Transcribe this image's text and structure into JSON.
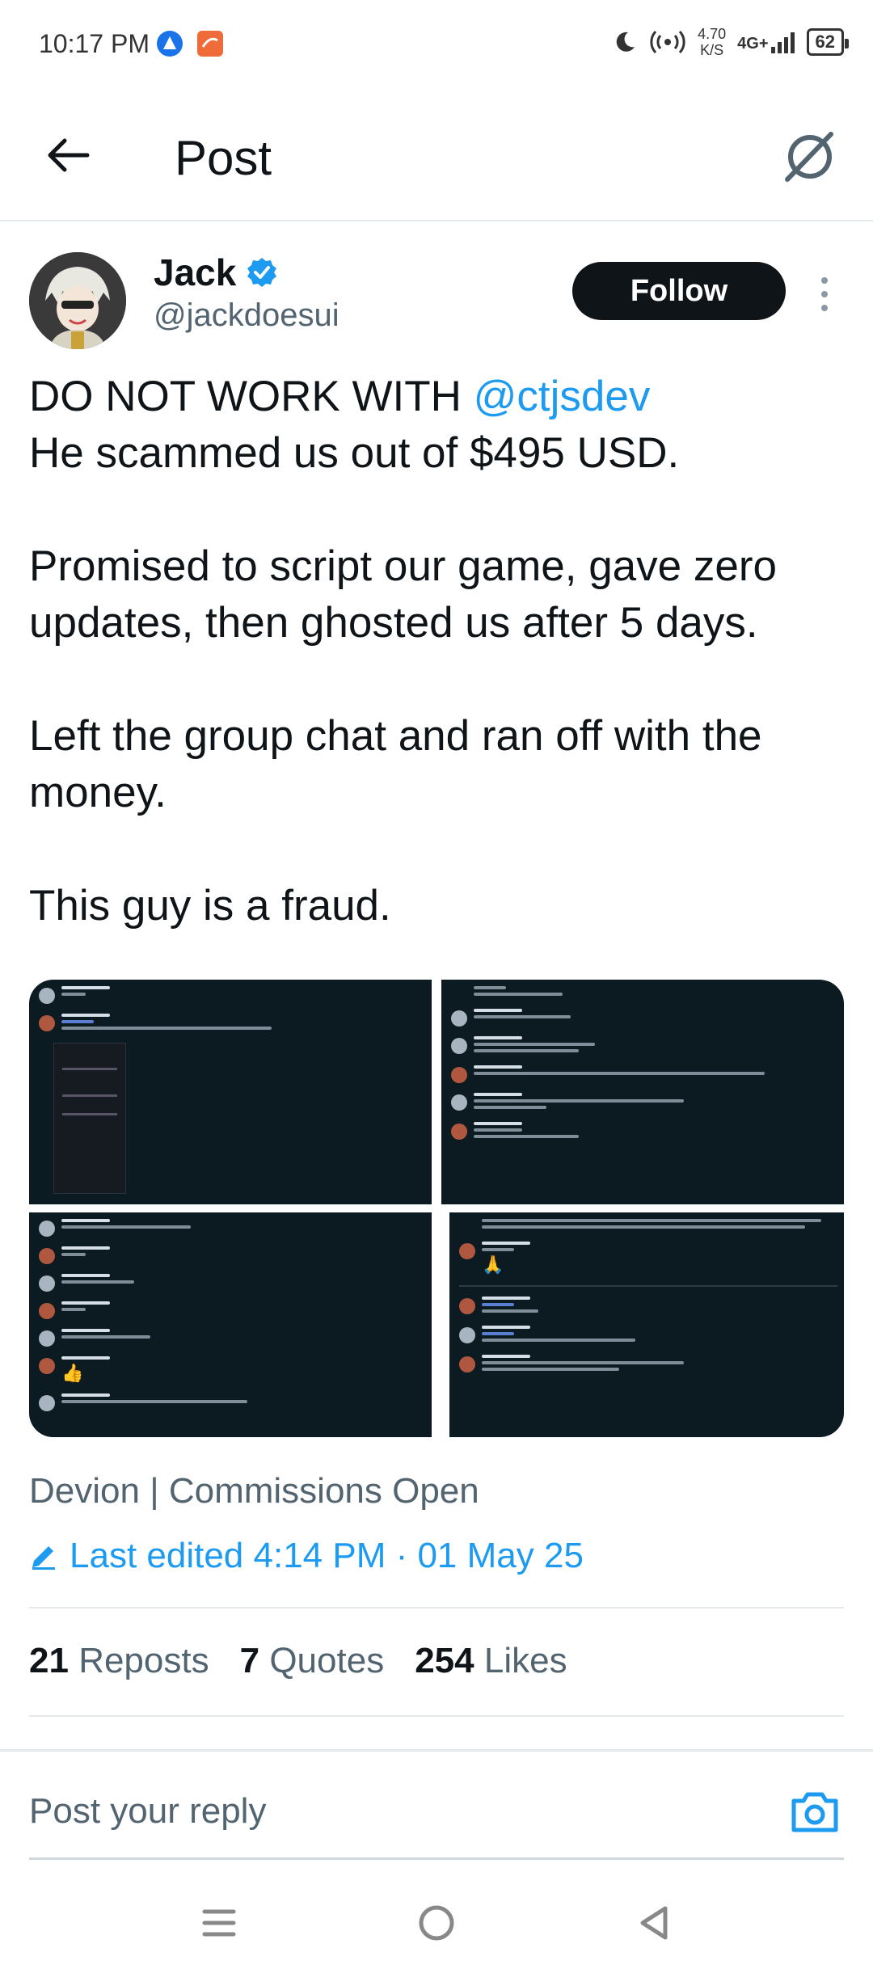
{
  "status_bar": {
    "time": "10:17 PM",
    "net_speed": "4.70",
    "net_unit": "K/S",
    "network": "4G+",
    "battery": "62"
  },
  "header": {
    "title": "Post"
  },
  "author": {
    "name": "Jack",
    "handle": "@jackdoesui",
    "follow_label": "Follow",
    "verified_color": "#1d9bf0"
  },
  "post": {
    "line1_prefix": "DO NOT WORK WITH ",
    "mention": "@ctjsdev",
    "line2": "He scammed us out of $495 USD.",
    "para2": "Promised to script our game, gave zero updates, then ghosted us after 5 days.",
    "para3": "Left the group chat and ran off with the money.",
    "para4": "This guy is a fraud."
  },
  "media": {
    "image_count": 4,
    "thumb_bg": "#0c1a22"
  },
  "meta": {
    "source": "Devion | Commissions Open",
    "edited": "Last edited 4:14 PM · 01 May 25"
  },
  "stats": {
    "reposts_count": "21",
    "reposts_label": "Reposts",
    "quotes_count": "7",
    "quotes_label": "Quotes",
    "likes_count": "254",
    "likes_label": "Likes"
  },
  "reply": {
    "placeholder": "Post your reply"
  },
  "colors": {
    "accent": "#1d9bf0",
    "text": "#0f1419",
    "secondary": "#536471"
  }
}
